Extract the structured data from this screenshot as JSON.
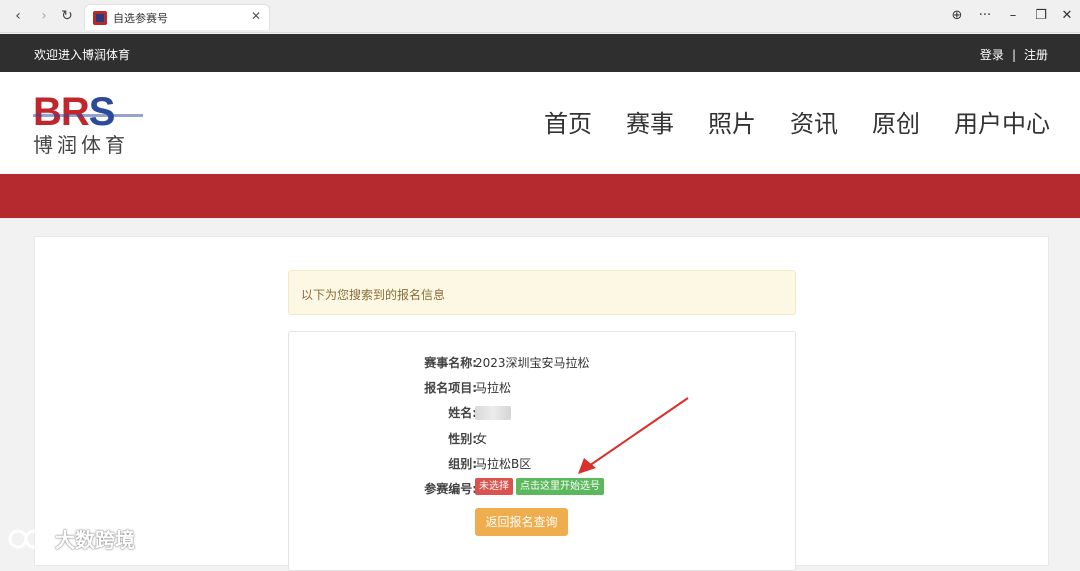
{
  "browser": {
    "tab_title": "自选参赛号",
    "back_icon": "‹",
    "forward_icon": "›",
    "reload_icon": "↻",
    "close_icon": "✕",
    "globe_icon": "⊕",
    "more_icon": "···",
    "minimize_icon": "–",
    "restore_icon": "❐",
    "window_close_icon": "✕"
  },
  "topbar": {
    "welcome": "欢迎进入博润体育",
    "login": "登录",
    "separator": "|",
    "register": "注册"
  },
  "header": {
    "logo_letters_br": "BR",
    "logo_letters_s": "S",
    "logo_cn": "博润体育",
    "nav": [
      "首页",
      "赛事",
      "照片",
      "资讯",
      "原创",
      "用户中心"
    ]
  },
  "alert": {
    "text": "以下为您搜索到的报名信息"
  },
  "info": {
    "event_label": "赛事名称:",
    "event_value": "2023深圳宝安马拉松",
    "item_label": "报名项目:",
    "item_value": "马拉松",
    "name_label": "姓名:",
    "gender_label": "性别:",
    "gender_value": "女",
    "group_label": "组别:",
    "group_value": "马拉松B区",
    "bib_label": "参赛编号:",
    "bib_status": "未选择",
    "bib_action": "点击这里开始选号",
    "return_button": "返回报名查询"
  },
  "watermark": {
    "text": "大数跨境"
  },
  "colors": {
    "brand_red": "#b52a2f",
    "topbar_bg": "#2f2f2f",
    "alert_bg": "#fcf8e3",
    "badge_red": "#d9534f",
    "badge_green": "#5cb85c",
    "button_orange": "#f0ad4e",
    "arrow_red": "#d9302c"
  }
}
